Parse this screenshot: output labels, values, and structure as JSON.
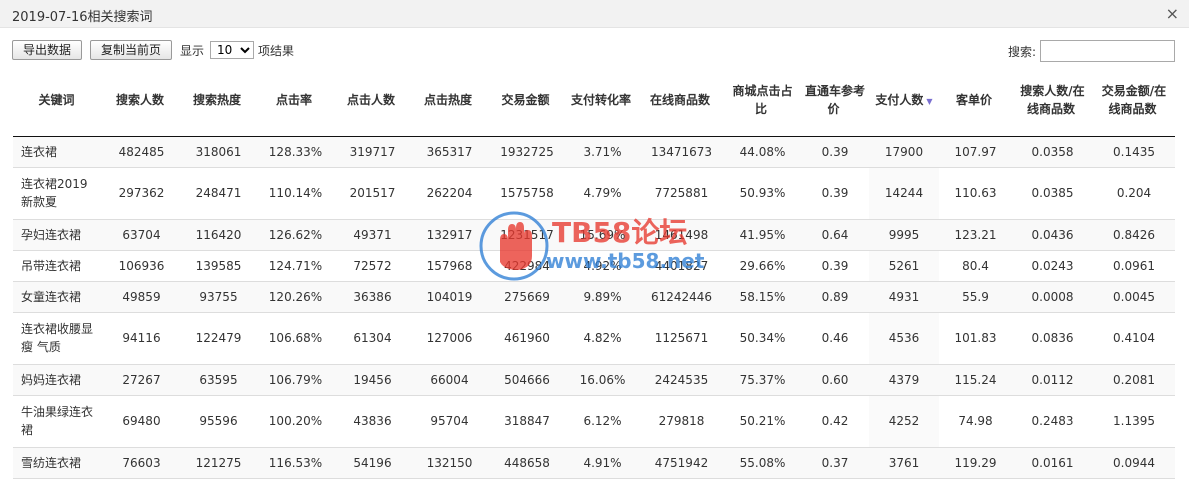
{
  "window": {
    "title": "2019-07-16相关搜索词",
    "close_glyph": "×"
  },
  "toolbar": {
    "export_label": "导出数据",
    "copy_label": "复制当前页",
    "show_label": "显示",
    "page_size": "10",
    "results_label": "项结果"
  },
  "search": {
    "label": "搜索:",
    "value": ""
  },
  "table": {
    "headers": [
      "关键词",
      "搜索人数",
      "搜索热度",
      "点击率",
      "点击人数",
      "点击热度",
      "交易金额",
      "支付转化率",
      "在线商品数",
      "商城点击占比",
      "直通车参考价",
      "支付人数",
      "客单价",
      "搜索人数/在线商品数",
      "交易金额/在线商品数"
    ],
    "sorted_column_index": 11,
    "rows": [
      [
        "连衣裙",
        "482485",
        "318061",
        "128.33%",
        "319717",
        "365317",
        "1932725",
        "3.71%",
        "13471673",
        "44.08%",
        "0.39",
        "17900",
        "107.97",
        "0.0358",
        "0.1435"
      ],
      [
        "连衣裙2019新款夏",
        "297362",
        "248471",
        "110.14%",
        "201517",
        "262204",
        "1575758",
        "4.79%",
        "7725881",
        "50.93%",
        "0.39",
        "14244",
        "110.63",
        "0.0385",
        "0.204"
      ],
      [
        "孕妇连衣裙",
        "63704",
        "116420",
        "126.62%",
        "49371",
        "132917",
        "1231517",
        "15.69%",
        "1461498",
        "41.95%",
        "0.64",
        "9995",
        "123.21",
        "0.0436",
        "0.8426"
      ],
      [
        "吊带连衣裙",
        "106936",
        "139585",
        "124.71%",
        "72572",
        "157968",
        "422984",
        "4.92%",
        "4401827",
        "29.66%",
        "0.39",
        "5261",
        "80.4",
        "0.0243",
        "0.0961"
      ],
      [
        "女童连衣裙",
        "49859",
        "93755",
        "120.26%",
        "36386",
        "104019",
        "275669",
        "9.89%",
        "61242446",
        "58.15%",
        "0.89",
        "4931",
        "55.9",
        "0.0008",
        "0.0045"
      ],
      [
        "连衣裙收腰显瘦 气质",
        "94116",
        "122479",
        "106.68%",
        "61304",
        "127006",
        "461960",
        "4.82%",
        "1125671",
        "50.34%",
        "0.46",
        "4536",
        "101.83",
        "0.0836",
        "0.4104"
      ],
      [
        "妈妈连衣裙",
        "27267",
        "63595",
        "106.79%",
        "19456",
        "66004",
        "504666",
        "16.06%",
        "2424535",
        "75.37%",
        "0.60",
        "4379",
        "115.24",
        "0.0112",
        "0.2081"
      ],
      [
        "牛油果绿连衣裙",
        "69480",
        "95596",
        "100.20%",
        "43836",
        "95704",
        "318847",
        "6.12%",
        "279818",
        "50.21%",
        "0.42",
        "4252",
        "74.98",
        "0.2483",
        "1.1395"
      ],
      [
        "雪纺连衣裙",
        "76603",
        "121275",
        "116.53%",
        "54196",
        "132150",
        "448658",
        "4.91%",
        "4751942",
        "55.08%",
        "0.37",
        "3761",
        "119.29",
        "0.0161",
        "0.0944"
      ]
    ]
  },
  "watermark": {
    "text_cn": "TB58论坛",
    "text_url": "www.tb58.net",
    "color_main": "#e8392f",
    "color_url": "#2f7fd6"
  },
  "colors": {
    "sorted_column_bg": "#f1f1f1",
    "sort_active": "#7a6fd0"
  }
}
